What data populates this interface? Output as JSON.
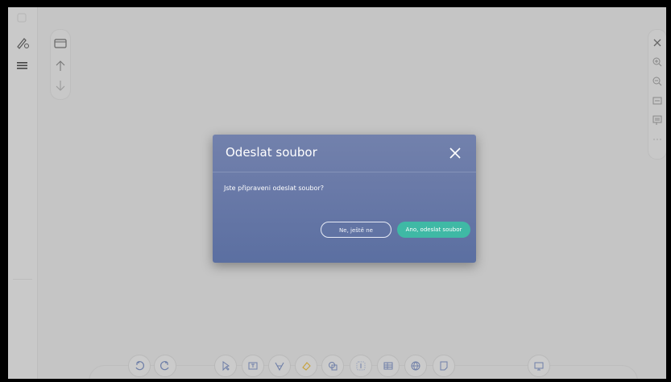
{
  "dialog": {
    "title": "Odeslat soubor",
    "message": "Jste připraveni odeslat soubor?",
    "cancel_label": "Ne, ještě ne",
    "confirm_label": "Ano, odeslat soubor"
  },
  "left_toolbar": {
    "items": [
      "pen-settings-icon",
      "menu-icon"
    ]
  },
  "page_nav": {
    "items": [
      "page-icon",
      "arrow-up-icon",
      "arrow-down-icon"
    ]
  },
  "right_toolbar": {
    "items": [
      "close-icon",
      "zoom-in-icon",
      "zoom-out-icon",
      "fit-width-icon",
      "comment-icon",
      "more-icon"
    ]
  },
  "bottom_toolbar": {
    "items": [
      "undo-icon",
      "redo-icon",
      "select-icon",
      "text-box-icon",
      "highlighter-icon",
      "eraser-icon",
      "shapes-icon",
      "insert-icon",
      "table-icon",
      "web-icon",
      "note-icon",
      "display-icon"
    ]
  },
  "colors": {
    "dialog_bg": "#6a7aa8",
    "primary": "#3fb9a5",
    "overlay": "#c5c5c5"
  }
}
